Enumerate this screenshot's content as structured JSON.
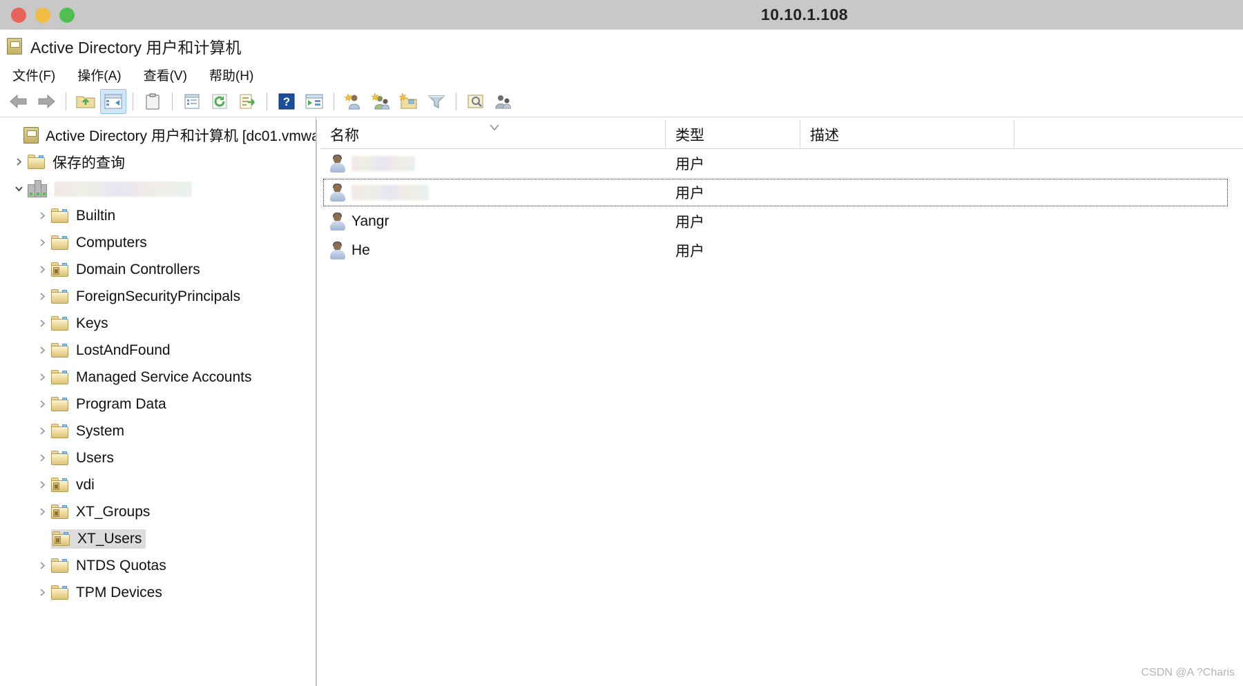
{
  "host": {
    "title": "10.10.1.108",
    "window_controls": [
      "close",
      "minimize",
      "maximize"
    ]
  },
  "app": {
    "title": "Active Directory 用户和计算机",
    "icon": "mmc-console-icon"
  },
  "menubar": [
    {
      "label": "文件(F)",
      "name": "menu-file"
    },
    {
      "label": "操作(A)",
      "name": "menu-action"
    },
    {
      "label": "查看(V)",
      "name": "menu-view"
    },
    {
      "label": "帮助(H)",
      "name": "menu-help"
    }
  ],
  "toolbar": [
    {
      "name": "back-button",
      "icon": "arrow-left-icon",
      "pressed": false
    },
    {
      "name": "forward-button",
      "icon": "arrow-right-icon",
      "pressed": false
    },
    {
      "name": "separator-1",
      "icon": "separator",
      "pressed": false
    },
    {
      "name": "up-one-level-button",
      "icon": "folder-up-icon",
      "pressed": false
    },
    {
      "name": "show-hide-tree-button",
      "icon": "console-tree-icon",
      "pressed": true
    },
    {
      "name": "separator-2",
      "icon": "separator",
      "pressed": false
    },
    {
      "name": "properties-button",
      "icon": "clipboard-icon",
      "pressed": false
    },
    {
      "name": "separator-3",
      "icon": "separator",
      "pressed": false
    },
    {
      "name": "view-details-button",
      "icon": "list-details-icon",
      "pressed": false
    },
    {
      "name": "refresh-button",
      "icon": "refresh-icon",
      "pressed": false
    },
    {
      "name": "export-list-button",
      "icon": "export-list-icon",
      "pressed": false
    },
    {
      "name": "separator-4",
      "icon": "separator",
      "pressed": false
    },
    {
      "name": "help-button",
      "icon": "question-mark-icon",
      "pressed": false
    },
    {
      "name": "show-actions-button",
      "icon": "action-pane-icon",
      "pressed": false
    },
    {
      "name": "separator-5",
      "icon": "separator",
      "pressed": false
    },
    {
      "name": "new-user-button",
      "icon": "new-user-icon",
      "pressed": false
    },
    {
      "name": "new-group-button",
      "icon": "new-group-icon",
      "pressed": false
    },
    {
      "name": "new-ou-button",
      "icon": "new-ou-icon",
      "pressed": false
    },
    {
      "name": "filter-button",
      "icon": "funnel-filter-icon",
      "pressed": false
    },
    {
      "name": "separator-6",
      "icon": "separator",
      "pressed": false
    },
    {
      "name": "find-button",
      "icon": "find-objects-icon",
      "pressed": false
    },
    {
      "name": "saved-query-button",
      "icon": "saved-query-users-icon",
      "pressed": false
    }
  ],
  "tree": [
    {
      "label": "Active Directory 用户和计算机 [dc01.vmwa",
      "indent": 0,
      "twisty": "none",
      "icon": "mmc-root-icon",
      "selected": false,
      "redacted": false
    },
    {
      "label": "保存的查询",
      "indent": 1,
      "twisty": "collapsed",
      "icon": "folder-icon",
      "selected": false,
      "redacted": false
    },
    {
      "label": "",
      "indent": 1,
      "twisty": "expanded",
      "icon": "domain-icon",
      "selected": false,
      "redacted": true,
      "redact_width": 200
    },
    {
      "label": "Builtin",
      "indent": 2,
      "twisty": "collapsed",
      "icon": "folder-icon",
      "selected": false,
      "redacted": false
    },
    {
      "label": "Computers",
      "indent": 2,
      "twisty": "collapsed",
      "icon": "folder-icon",
      "selected": false,
      "redacted": false
    },
    {
      "label": "Domain Controllers",
      "indent": 2,
      "twisty": "collapsed",
      "icon": "ou-folder-icon",
      "selected": false,
      "redacted": false
    },
    {
      "label": "ForeignSecurityPrincipals",
      "indent": 2,
      "twisty": "collapsed",
      "icon": "folder-icon",
      "selected": false,
      "redacted": false
    },
    {
      "label": "Keys",
      "indent": 2,
      "twisty": "collapsed",
      "icon": "folder-icon",
      "selected": false,
      "redacted": false
    },
    {
      "label": "LostAndFound",
      "indent": 2,
      "twisty": "collapsed",
      "icon": "folder-icon",
      "selected": false,
      "redacted": false
    },
    {
      "label": "Managed Service Accounts",
      "indent": 2,
      "twisty": "collapsed",
      "icon": "folder-icon",
      "selected": false,
      "redacted": false
    },
    {
      "label": "Program Data",
      "indent": 2,
      "twisty": "collapsed",
      "icon": "folder-icon",
      "selected": false,
      "redacted": false
    },
    {
      "label": "System",
      "indent": 2,
      "twisty": "collapsed",
      "icon": "folder-icon",
      "selected": false,
      "redacted": false
    },
    {
      "label": "Users",
      "indent": 2,
      "twisty": "collapsed",
      "icon": "folder-icon",
      "selected": false,
      "redacted": false
    },
    {
      "label": "vdi",
      "indent": 2,
      "twisty": "collapsed",
      "icon": "ou-folder-icon",
      "selected": false,
      "redacted": false
    },
    {
      "label": "XT_Groups",
      "indent": 2,
      "twisty": "collapsed",
      "icon": "ou-folder-icon",
      "selected": false,
      "redacted": false
    },
    {
      "label": "XT_Users",
      "indent": 2,
      "twisty": "none",
      "icon": "ou-folder-icon",
      "selected": true,
      "redacted": false
    },
    {
      "label": "NTDS Quotas",
      "indent": 2,
      "twisty": "collapsed",
      "icon": "folder-icon",
      "selected": false,
      "redacted": false
    },
    {
      "label": "TPM Devices",
      "indent": 2,
      "twisty": "collapsed",
      "icon": "folder-icon",
      "selected": false,
      "redacted": false
    }
  ],
  "list": {
    "columns": [
      {
        "label": "名称",
        "name": "column-name",
        "sorted": true,
        "sort_direction": "descending"
      },
      {
        "label": "类型",
        "name": "column-type",
        "sorted": false,
        "sort_direction": ""
      },
      {
        "label": "描述",
        "name": "column-description",
        "sorted": false,
        "sort_direction": ""
      }
    ],
    "rows": [
      {
        "name": "",
        "type": "用户",
        "description": "",
        "icon": "user-icon",
        "redacted": true,
        "redact_width": 92,
        "focused": false
      },
      {
        "name": "",
        "type": "用户",
        "description": "",
        "icon": "user-icon",
        "redacted": true,
        "redact_width": 112,
        "focused": true
      },
      {
        "name": "Yangr",
        "type": "用户",
        "description": "",
        "icon": "user-icon",
        "redacted": false,
        "focused": false
      },
      {
        "name": "He",
        "type": "用户",
        "description": "",
        "icon": "user-icon",
        "redacted": false,
        "focused": false
      }
    ]
  },
  "watermark": {
    "text": "CSDN @A ?Charis"
  },
  "colors": {
    "host_titlebar": "#c8c8c8",
    "close_dot": "#e8635a",
    "min_dot": "#f2bb42",
    "max_dot": "#4fc04f",
    "selection": "#dcdcdc",
    "toolbar_pressed": "#cfe6fb"
  }
}
